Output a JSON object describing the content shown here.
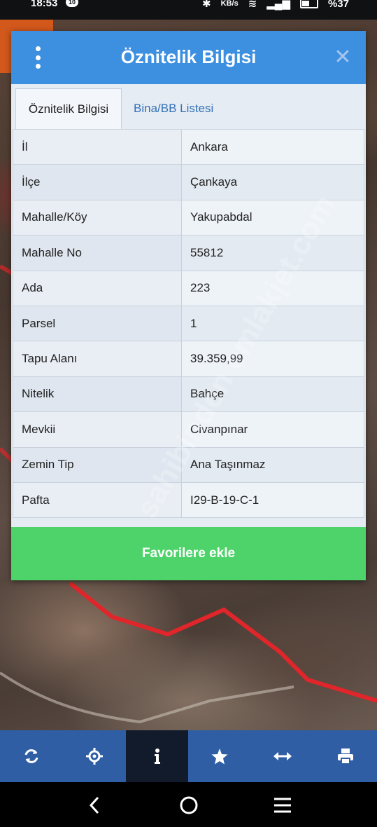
{
  "status_bar": {
    "time": "18:53",
    "notification_badge": "10",
    "network_speed": "KB/s",
    "battery": "%37"
  },
  "dialog": {
    "title": "Öznitelik Bilgisi",
    "menu_icon": "more-vertical-icon",
    "close_icon": "close-icon",
    "tabs": [
      {
        "label": "Öznitelik Bilgisi",
        "active": true
      },
      {
        "label": "Bina/BB Listesi",
        "active": false
      }
    ],
    "rows": [
      {
        "key": "İl",
        "value": "Ankara"
      },
      {
        "key": "İlçe",
        "value": "Çankaya"
      },
      {
        "key": "Mahalle/Köy",
        "value": "Yakupabdal"
      },
      {
        "key": "Mahalle No",
        "value": "55812"
      },
      {
        "key": "Ada",
        "value": "223"
      },
      {
        "key": "Parsel",
        "value": "1"
      },
      {
        "key": "Tapu Alanı",
        "value": "39.359,99"
      },
      {
        "key": "Nitelik",
        "value": "Bahçe"
      },
      {
        "key": "Mevkii",
        "value": "Civanpınar"
      },
      {
        "key": "Zemin Tip",
        "value": "Ana Taşınmaz"
      },
      {
        "key": "Pafta",
        "value": "I29-B-19-C-1"
      }
    ],
    "favorite_button": "Favorilere ekle"
  },
  "watermark": "sahibinden emlakjet.com",
  "toolbar": {
    "buttons": [
      {
        "icon": "refresh-icon",
        "active": false
      },
      {
        "icon": "locate-icon",
        "active": false
      },
      {
        "icon": "info-icon",
        "active": true
      },
      {
        "icon": "star-icon",
        "active": false
      },
      {
        "icon": "measure-arrows-icon",
        "active": false
      },
      {
        "icon": "print-icon",
        "active": false
      }
    ]
  },
  "navbar": {
    "buttons": [
      "back-icon",
      "home-icon",
      "recent-apps-icon"
    ]
  },
  "colors": {
    "header": "#3d8fe0",
    "favorite_button": "#4ed36a",
    "toolbar": "#2f5ea5",
    "parcel_line": "#e0262a"
  }
}
